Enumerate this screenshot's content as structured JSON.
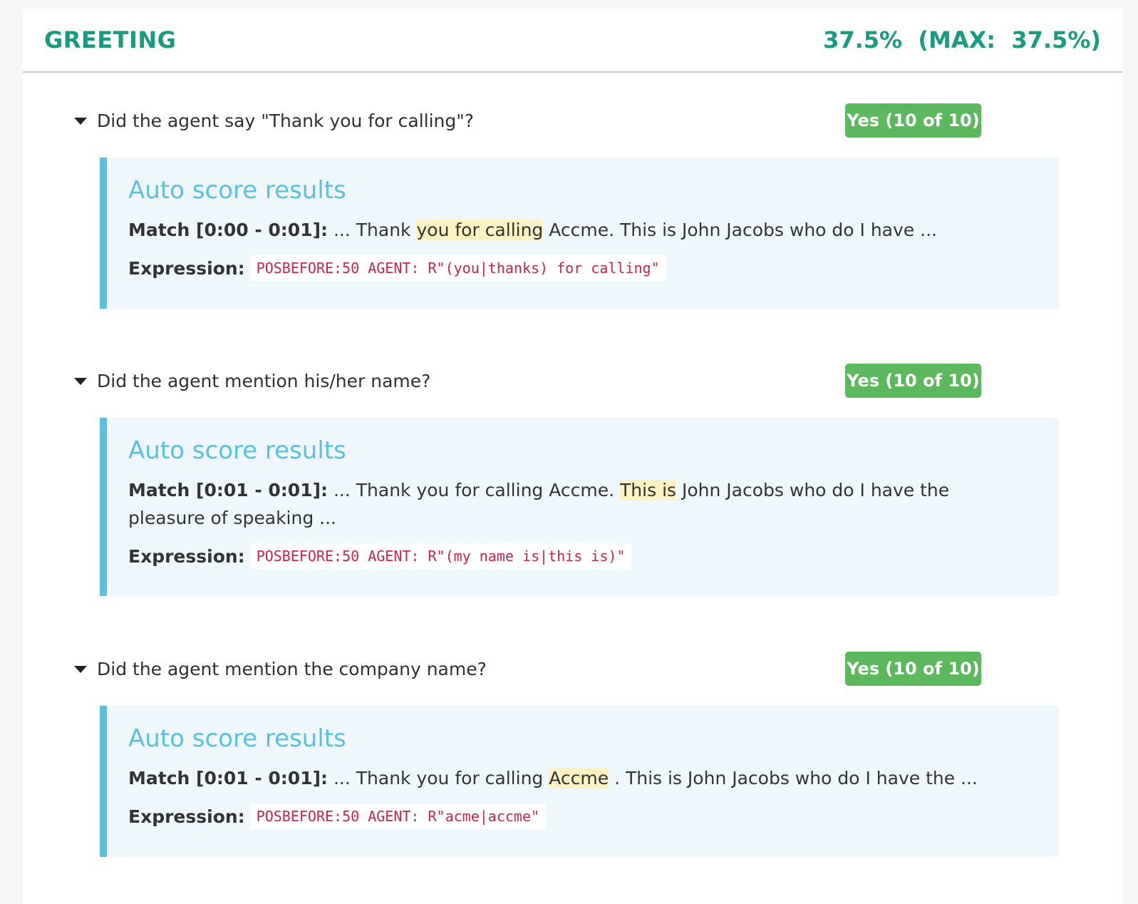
{
  "section": {
    "title": "GREETING",
    "score": "37.5%  (MAX:  37.5%)"
  },
  "questions": [
    {
      "text": "Did the agent say \"Thank you for calling\"?",
      "badge": "Yes (10 of 10)",
      "result": {
        "title": "Auto score results",
        "match_label": "Match [0:00 - 0:01]:",
        "match_before": " ... Thank ",
        "match_highlight": "you for calling",
        "match_after": " Accme. This is John Jacobs who do I have ...",
        "expression_label": "Expression:",
        "expression": "POSBEFORE:50 AGENT: R\"(you|thanks) for calling\""
      }
    },
    {
      "text": "Did the agent mention his/her name?",
      "badge": "Yes (10 of 10)",
      "result": {
        "title": "Auto score results",
        "match_label": "Match [0:01 - 0:01]:",
        "match_before": " ... Thank you for calling Accme. ",
        "match_highlight": "This is",
        "match_after": " John Jacobs who do I have the pleasure of speaking ...",
        "expression_label": "Expression:",
        "expression": "POSBEFORE:50 AGENT: R\"(my name is|this is)\""
      }
    },
    {
      "text": "Did the agent mention the company name?",
      "badge": "Yes (10 of 10)",
      "result": {
        "title": "Auto score results",
        "match_label": "Match [0:01 - 0:01]:",
        "match_before": " ... Thank you for calling ",
        "match_highlight": "Accme",
        "match_after": " . This is John Jacobs who do I have the ...",
        "expression_label": "Expression:",
        "expression": "POSBEFORE:50 AGENT: R\"acme|accme\""
      }
    }
  ],
  "colors": {
    "section_title": "#1a9a80",
    "badge_bg": "#5cb85c",
    "result_accent": "#5bc0de",
    "result_bg": "#eef7fb",
    "highlight": "#fcf1c2",
    "code_text": "#c7254e"
  },
  "icons": {
    "collapse_toggle": "caret-down-icon"
  }
}
